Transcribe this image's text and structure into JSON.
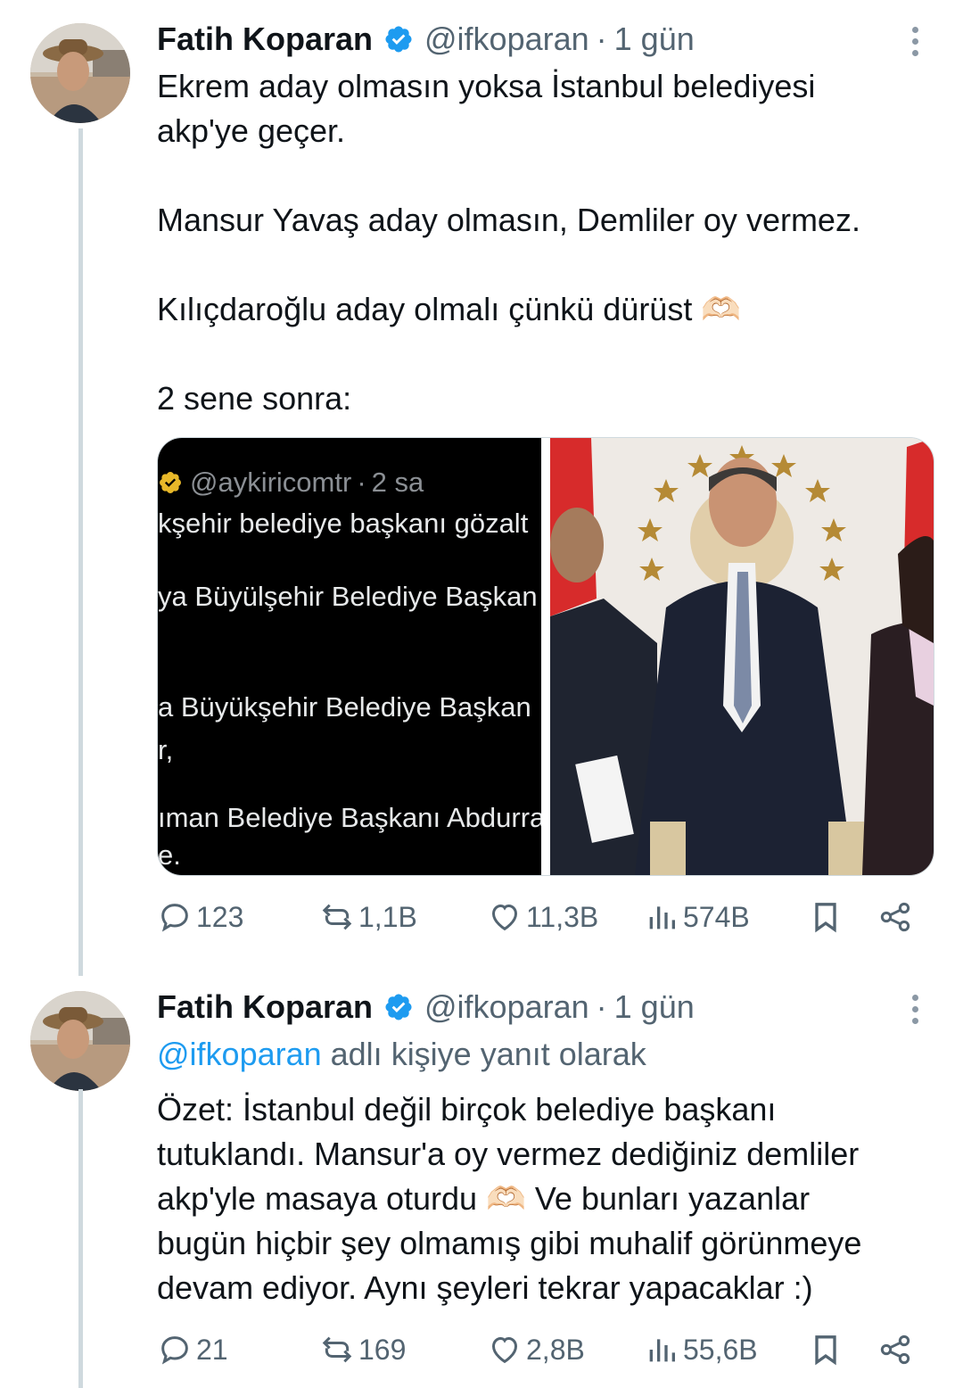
{
  "tweets": [
    {
      "author": {
        "name": "Fatih Koparan",
        "handle": "@ifkoparan",
        "time": "1 gün",
        "separator": "·"
      },
      "text_lines": [
        "Ekrem aday olmasın yoksa İstanbul belediyesi",
        "akp'ye geçer.",
        "",
        "Mansur Yavaş aday olmasın, Demliler oy vermez.",
        "",
        "Kılıçdaroğlu aday olmalı çünkü dürüst 🫶🏻",
        "",
        "2 sene sonra:"
      ],
      "media": {
        "screenshot": {
          "handle": "@aykiricomtr",
          "time": "2 sa",
          "lines": [
            "kşehir belediye başkanı gözalt",
            "ya Büyülşehir Belediye Başkan",
            "a Büyükşehir Belediye Başkan",
            "r,",
            "ıman Belediye Başkanı Abdurra",
            "e."
          ]
        }
      },
      "actions": {
        "replies": "123",
        "retweets": "1,1B",
        "likes": "11,3B",
        "views": "574B"
      }
    },
    {
      "author": {
        "name": "Fatih Koparan",
        "handle": "@ifkoparan",
        "time": "1 gün",
        "separator": "·"
      },
      "reply_to": {
        "mention": "@ifkoparan",
        "suffix": " adlı kişiye yanıt olarak"
      },
      "text_lines": [
        "Özet: İstanbul değil birçok belediye başkanı",
        "tutuklandı. Mansur'a oy vermez dediğiniz demliler",
        "akp'yle masaya oturdu 🫶🏻 Ve bunları yazanlar",
        "bugün hiçbir şey olmamış gibi muhalif görünmeye",
        "devam ediyor. Aynı şeyleri tekrar yapacaklar :)"
      ],
      "actions": {
        "replies": "21",
        "retweets": "169",
        "likes": "2,8B",
        "views": "55,6B"
      }
    }
  ],
  "colors": {
    "accent": "#1d9bf0",
    "muted": "#536471",
    "thread": "#cfd9de"
  }
}
